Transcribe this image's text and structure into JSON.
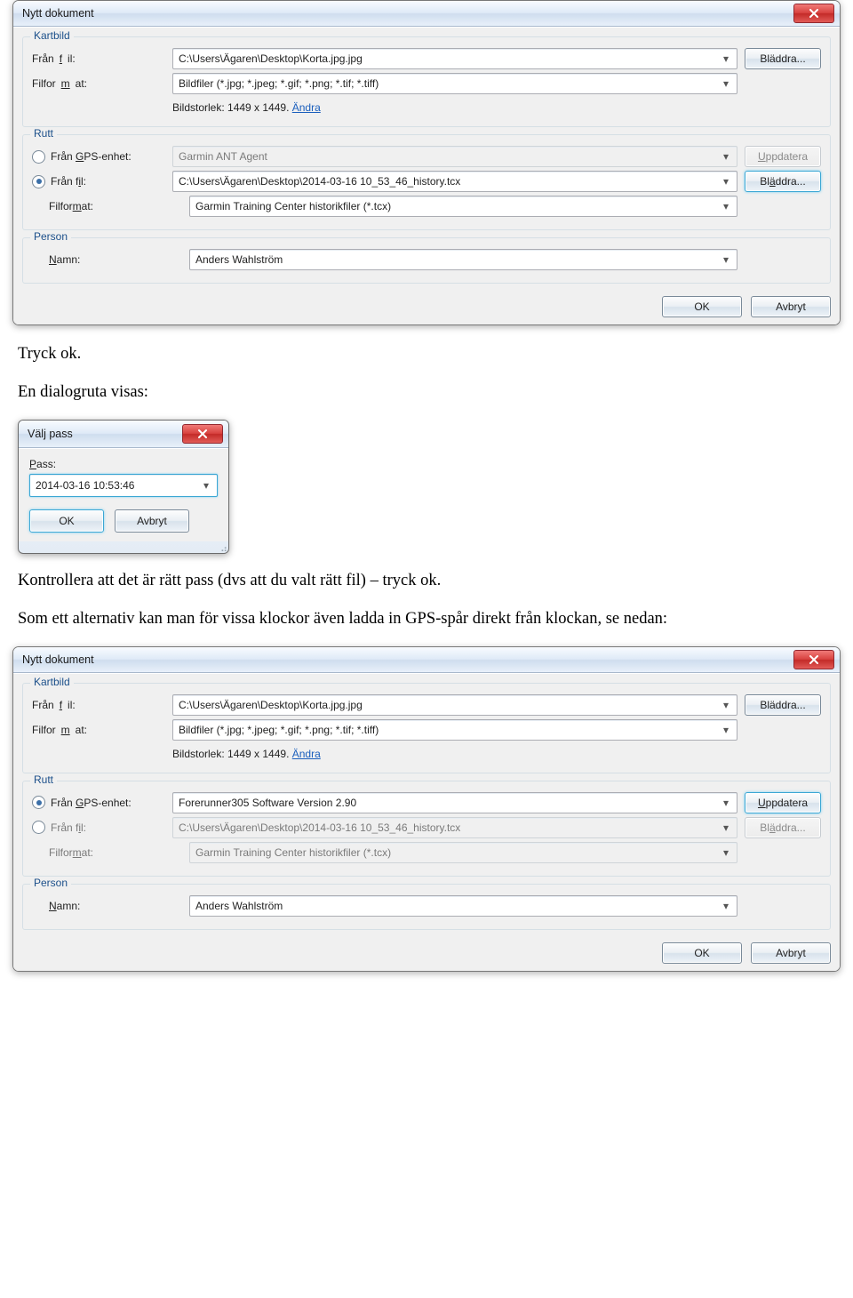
{
  "dialog1": {
    "title": "Nytt dokument",
    "group_kartbild": {
      "legend": "Kartbild",
      "fran_fil_label_pre": "Från ",
      "fran_fil_u": "f",
      "fran_fil_label_post": "il:",
      "fran_fil_value": "C:\\Users\\Ägaren\\Desktop\\Korta.jpg.jpg",
      "bladdra": "Bläddra...",
      "filformat_label_pre": "Filfor",
      "filformat_u": "m",
      "filformat_label_post": "at:",
      "filformat_value": "Bildfiler  (*.jpg; *.jpeg; *.gif; *.png; *.tif; *.tiff)",
      "bildstorlek_text": "Bildstorlek: 1449 x 1449. ",
      "andra": "Ändra"
    },
    "group_rutt": {
      "legend": "Rutt",
      "gps": {
        "label_pre": "Från ",
        "u": "G",
        "label_post": "PS-enhet:",
        "value": "Garmin ANT Agent",
        "uppdatera": "Uppdatera"
      },
      "fil": {
        "label_pre": "Från f",
        "u": "i",
        "label_post": "l:",
        "value": "C:\\Users\\Ägaren\\Desktop\\2014-03-16 10_53_46_history.tcx",
        "bladdra": "Bläddra..."
      },
      "format": {
        "label_pre": "Filfor",
        "u": "m",
        "label_post": "at:",
        "value": "Garmin Training Center historikfiler (*.tcx)"
      }
    },
    "group_person": {
      "legend": "Person",
      "namn": {
        "u": "N",
        "label_post": "amn:",
        "value": "Anders Wahlström"
      }
    },
    "footer": {
      "ok": "OK",
      "avbryt": "Avbryt"
    }
  },
  "prose1": "Tryck ok.",
  "prose2": "En dialogruta visas:",
  "mini": {
    "title": "Välj pass",
    "pass": {
      "u": "P",
      "label_post": "ass:",
      "value": "2014-03-16 10:53:46"
    },
    "ok": "OK",
    "avbryt": "Avbryt"
  },
  "prose3": "Kontrollera att det är rätt pass (dvs att du valt rätt fil) – tryck ok.",
  "prose4": "Som ett alternativ kan man för vissa klockor även ladda in GPS-spår direkt från klockan, se nedan:",
  "dialog2": {
    "title": "Nytt dokument",
    "group_kartbild": {
      "legend": "Kartbild",
      "fran_fil_label_pre": "Från ",
      "fran_fil_u": "f",
      "fran_fil_label_post": "il:",
      "fran_fil_value": "C:\\Users\\Ägaren\\Desktop\\Korta.jpg.jpg",
      "bladdra": "Bläddra...",
      "filformat_label_pre": "Filfor",
      "filformat_u": "m",
      "filformat_label_post": "at:",
      "filformat_value": "Bildfiler  (*.jpg; *.jpeg; *.gif; *.png; *.tif; *.tiff)",
      "bildstorlek_text": "Bildstorlek: 1449 x 1449. ",
      "andra": "Ändra"
    },
    "group_rutt": {
      "legend": "Rutt",
      "gps": {
        "label_pre": "Från ",
        "u": "G",
        "label_post": "PS-enhet:",
        "value": "Forerunner305 Software Version 2.90",
        "uppdatera": "Uppdatera"
      },
      "fil": {
        "label_pre": "Från f",
        "u": "i",
        "label_post": "l:",
        "value": "C:\\Users\\Ägaren\\Desktop\\2014-03-16 10_53_46_history.tcx",
        "bladdra": "Bläddra..."
      },
      "format": {
        "label_pre": "Filfor",
        "u": "m",
        "label_post": "at:",
        "value": "Garmin Training Center historikfiler (*.tcx)"
      }
    },
    "group_person": {
      "legend": "Person",
      "namn": {
        "u": "N",
        "label_post": "amn:",
        "value": "Anders Wahlström"
      }
    },
    "footer": {
      "ok": "OK",
      "avbryt": "Avbryt"
    }
  }
}
